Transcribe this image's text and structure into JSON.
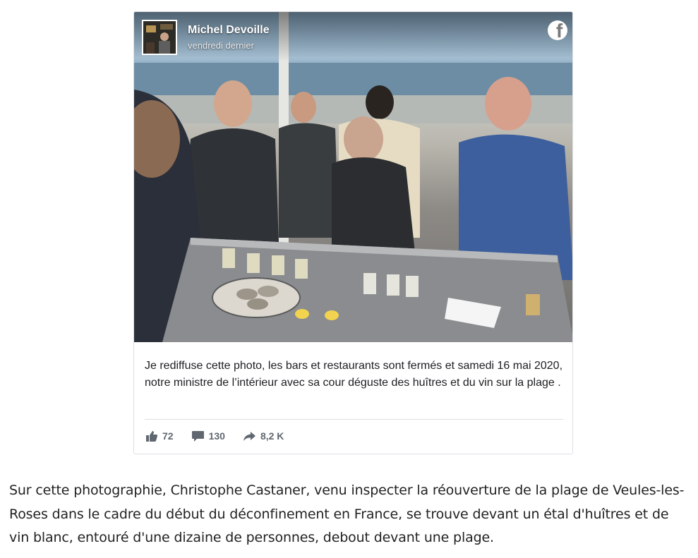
{
  "post": {
    "author_name": "Michel Devoille",
    "time": "vendredi dernier",
    "network_icon": "facebook-icon",
    "text": "Je rediffuse cette photo, les bars et restaurants sont fermés et samedi 16 mai 2020, notre ministre de l’intérieur avec sa cour déguste des huîtres et du vin sur la plage .",
    "stats": {
      "likes": "72",
      "comments": "130",
      "shares": "8,2 K"
    }
  },
  "article": {
    "paragraph": "Sur cette photographie, Christophe Castaner, venu inspecter la réouverture de la plage de Veules-les-Roses dans le cadre du début du déconfinement en France, se trouve devant un étal d'huîtres et de vin blanc, entouré d'une dizaine de personnes, debout devant une plage."
  },
  "colors": {
    "text_primary": "#1c1e21",
    "text_secondary": "#606770",
    "card_border": "#dddfe2"
  }
}
